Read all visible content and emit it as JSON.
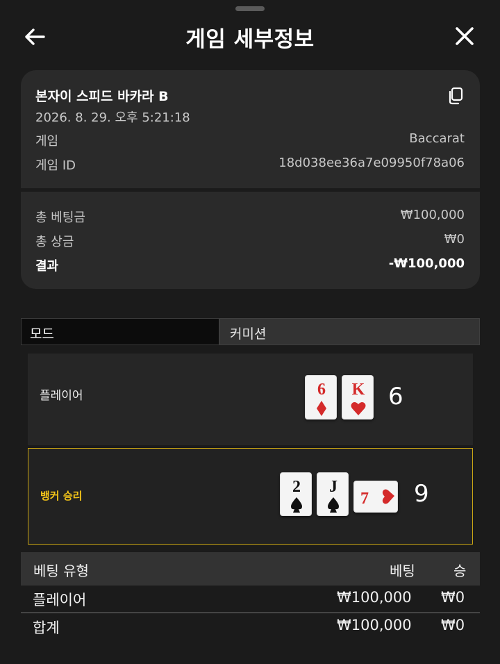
{
  "header": {
    "title": "게임 세부정보",
    "back_icon": "arrow-left-icon",
    "close_icon": "close-icon"
  },
  "summary": {
    "table_name": "본자이 스피드 바카라 B",
    "datetime": "2026. 8. 29. 오후 5:21:18",
    "copy_icon": "copy-icon",
    "game_label": "게임",
    "game_value": "Baccarat",
    "game_id_label": "게임 ID",
    "game_id_value": "18d038ee36a7e09950f78a06",
    "total_bet_label": "총 베팅금",
    "total_bet_value": "₩100,000",
    "total_win_label": "총 상금",
    "total_win_value": "₩0",
    "result_label": "결과",
    "result_value": "-₩100,000"
  },
  "mode": {
    "label": "모드",
    "value": "커미션"
  },
  "hands": {
    "player": {
      "label": "플레이어",
      "score": "6",
      "cards": [
        {
          "rank": "6",
          "suit": "diamond",
          "color": "#d42a2a"
        },
        {
          "rank": "K",
          "suit": "heart",
          "color": "#d42a2a"
        }
      ]
    },
    "banker": {
      "label": "뱅커 승리",
      "score": "9",
      "cards": [
        {
          "rank": "2",
          "suit": "spade",
          "color": "#111111"
        },
        {
          "rank": "J",
          "suit": "spade",
          "color": "#111111"
        },
        {
          "rank": "7",
          "suit": "heart",
          "color": "#d42a2a"
        }
      ]
    }
  },
  "bets": {
    "columns": [
      "베팅 유형",
      "베팅",
      "승"
    ],
    "rows": [
      {
        "type": "플레이어",
        "bet": "₩100,000",
        "win": "₩0"
      }
    ],
    "total": {
      "type": "합계",
      "bet": "₩100,000",
      "win": "₩0"
    }
  },
  "colors": {
    "winner_accent": "#f3c418",
    "red_suit": "#d42a2a"
  }
}
